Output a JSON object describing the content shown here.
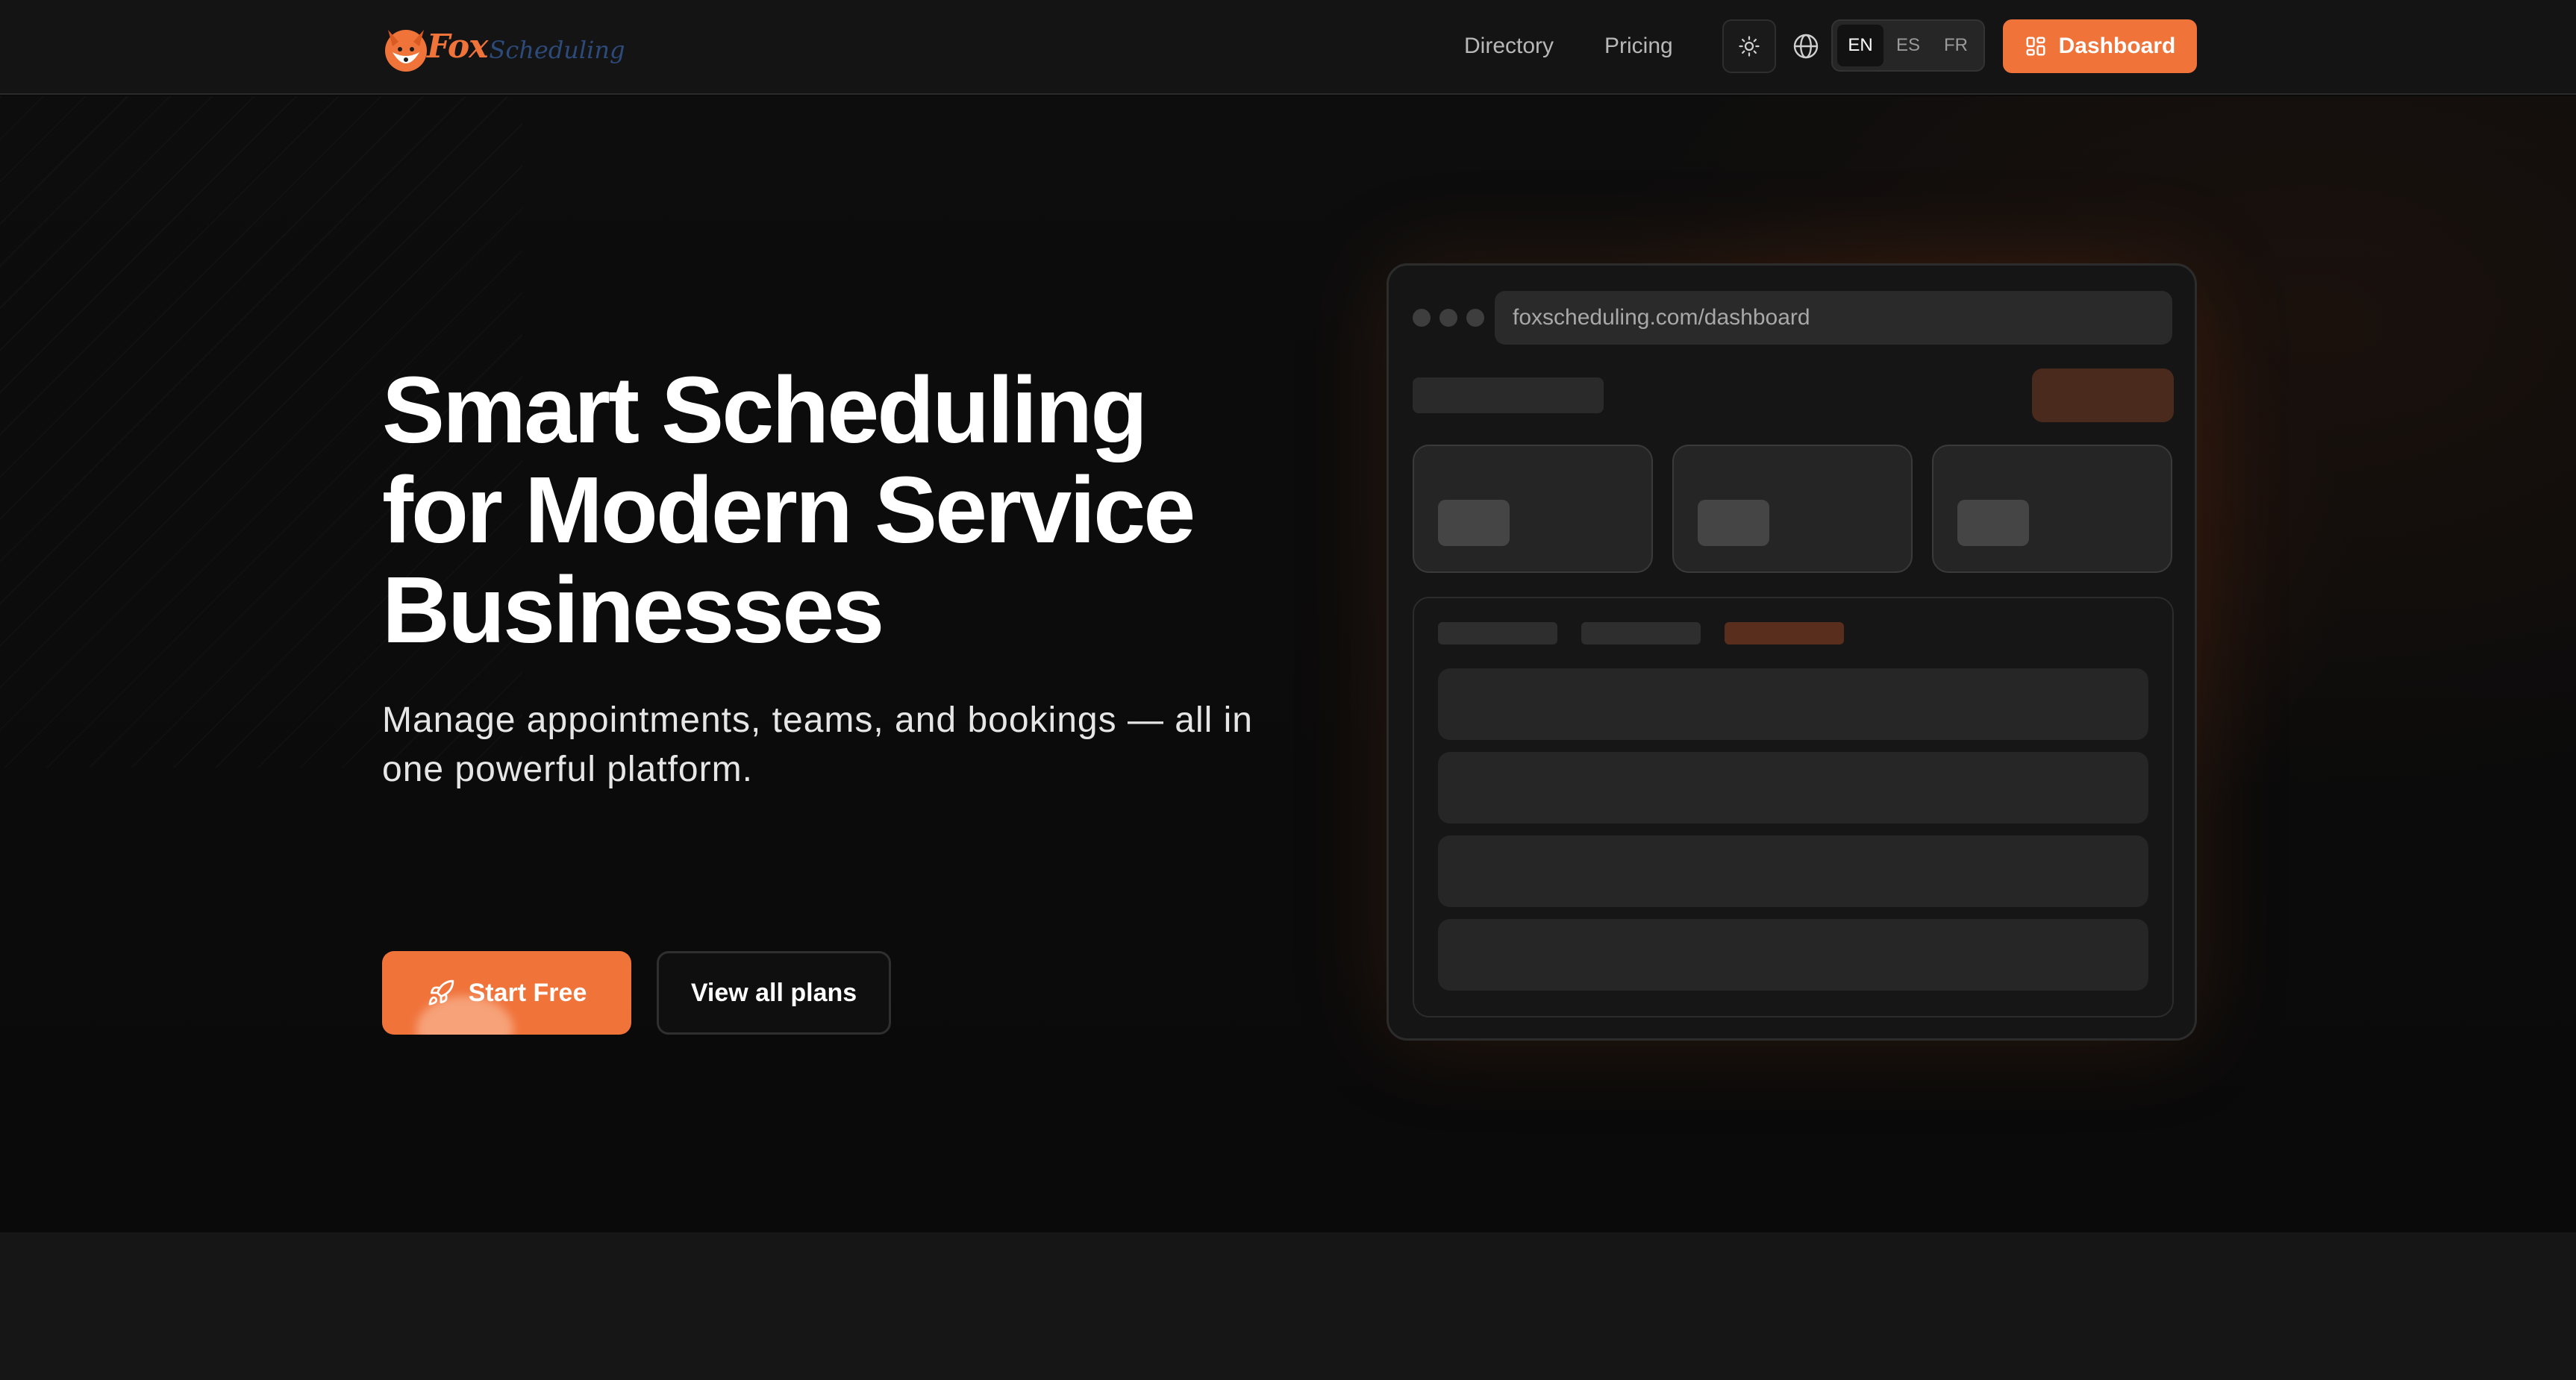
{
  "brand": {
    "name_primary": "Fox",
    "name_secondary": "Scheduling",
    "accent_color": "#f0733a",
    "logo_icon": "fox-logo-icon"
  },
  "nav": {
    "links": [
      {
        "label": "Directory"
      },
      {
        "label": "Pricing"
      }
    ],
    "theme_toggle_icon": "sun-icon",
    "language_icon": "globe-icon",
    "languages": [
      {
        "code": "EN",
        "active": true
      },
      {
        "code": "ES",
        "active": false
      },
      {
        "code": "FR",
        "active": false
      }
    ],
    "dashboard_button": {
      "label": "Dashboard",
      "icon": "grid-icon"
    }
  },
  "hero": {
    "headline": "Smart Scheduling for Modern Service Businesses",
    "subheadline": "Manage appointments, teams, and bookings — all in one powerful platform.",
    "primary_cta": {
      "label": "Start Free",
      "icon": "rocket-icon"
    },
    "secondary_cta": {
      "label": "View all plans"
    }
  },
  "preview": {
    "url": "foxscheduling.com/dashboard"
  }
}
